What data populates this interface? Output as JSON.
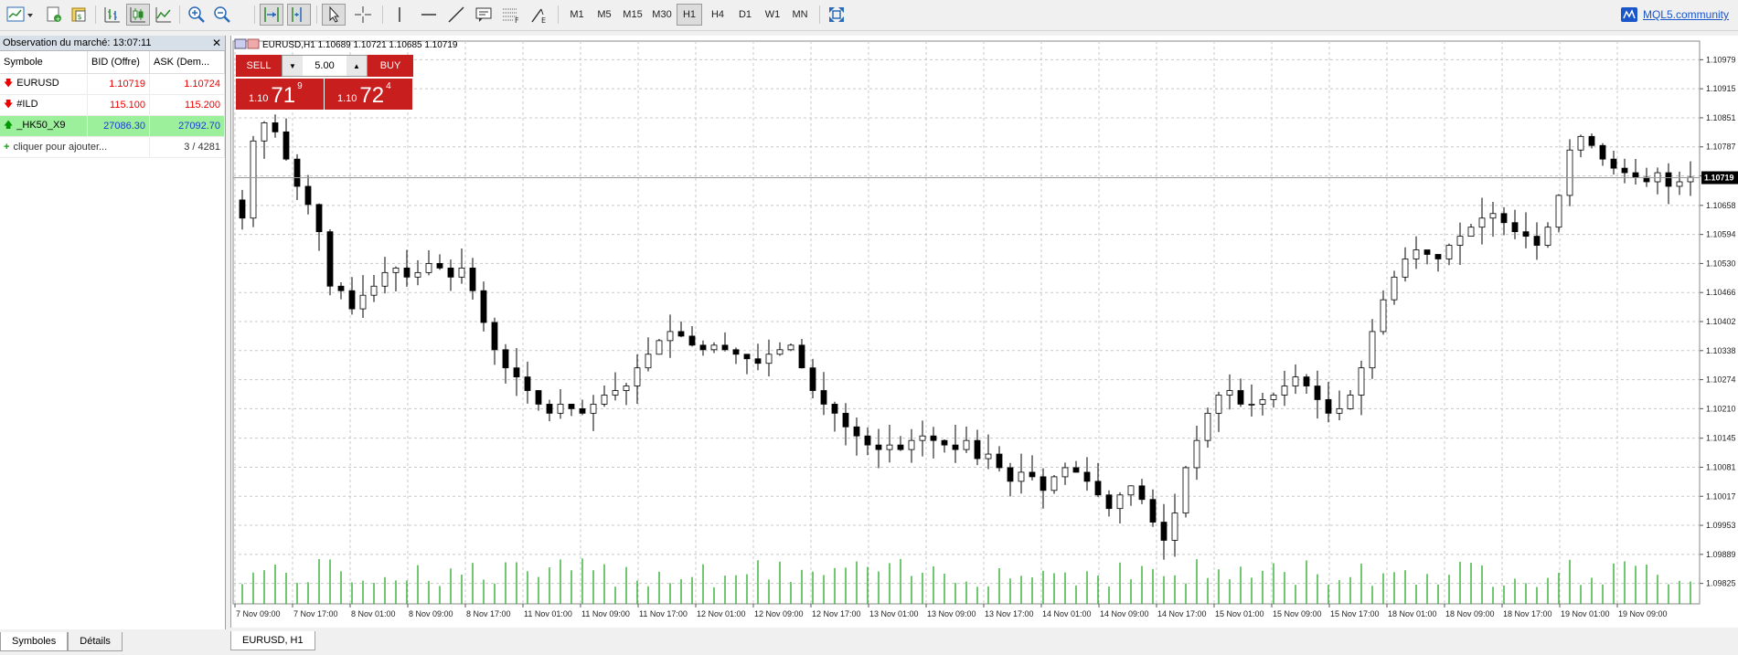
{
  "toolbar": {
    "timeframes": [
      "M1",
      "M5",
      "M15",
      "M30",
      "H1",
      "H4",
      "D1",
      "W1",
      "MN"
    ],
    "active_timeframe": "H1",
    "community_label": "MQL5.community"
  },
  "market_watch": {
    "title": "Observation du marché: 13:07:11",
    "columns": [
      "Symbole",
      "BID (Offre)",
      "ASK (Dem..."
    ],
    "rows": [
      {
        "symbol": "EURUSD",
        "bid": "1.10719",
        "ask": "1.10724",
        "dir": "down"
      },
      {
        "symbol": "#ILD",
        "bid": "115.100",
        "ask": "115.200",
        "dir": "down"
      },
      {
        "symbol": "_HK50_X9",
        "bid": "27086.30",
        "ask": "27092.70",
        "dir": "up"
      }
    ],
    "add_label": "cliquer pour ajouter...",
    "count": "3 / 4281"
  },
  "bottom_tabs": {
    "symbols": "Symboles",
    "details": "Détails"
  },
  "chart": {
    "header": "EURUSD,H1  1.10689 1.10721 1.10685 1.10719",
    "tab_label": "EURUSD, H1",
    "current_price_label": "1.10719",
    "colors": {
      "bull": "#ffffff",
      "bear": "#000000",
      "volume": "#22aa22",
      "grid": "#c8c8c8",
      "price_tag_bg": "#000000"
    }
  },
  "trade_panel": {
    "sell_label": "SELL",
    "buy_label": "BUY",
    "lot": "5.00",
    "sell_prefix": "1.10",
    "sell_big": "71",
    "sell_sup": "9",
    "buy_prefix": "1.10",
    "buy_big": "72",
    "buy_sup": "4"
  },
  "chart_data": {
    "type": "candlestick",
    "y_ticks": [
      "1.10979",
      "1.10915",
      "1.10851",
      "1.10787",
      "1.10723",
      "1.10658",
      "1.10594",
      "1.10530",
      "1.10466",
      "1.10402",
      "1.10338",
      "1.10274",
      "1.10210",
      "1.10145",
      "1.10081",
      "1.10017",
      "1.09953",
      "1.09889",
      "1.09825"
    ],
    "ylim": [
      1.0978,
      1.1102
    ],
    "x_ticks": [
      "7 Nov 09:00",
      "7 Nov 17:00",
      "8 Nov 01:00",
      "8 Nov 09:00",
      "8 Nov 17:00",
      "11 Nov 01:00",
      "11 Nov 09:00",
      "11 Nov 17:00",
      "12 Nov 01:00",
      "12 Nov 09:00",
      "12 Nov 17:00",
      "13 Nov 01:00",
      "13 Nov 09:00",
      "13 Nov 17:00",
      "14 Nov 01:00",
      "14 Nov 09:00",
      "14 Nov 17:00",
      "15 Nov 01:00",
      "15 Nov 09:00",
      "15 Nov 17:00",
      "18 Nov 01:00",
      "18 Nov 09:00",
      "18 Nov 17:00",
      "19 Nov 01:00",
      "19 Nov 09:00"
    ],
    "close_path": [
      1.1063,
      1.108,
      1.1084,
      1.1082,
      1.1076,
      1.107,
      1.1066,
      1.106,
      1.1048,
      1.1047,
      1.1043,
      1.1046,
      1.1048,
      1.1051,
      1.1052,
      1.105,
      1.1051,
      1.1053,
      1.1052,
      1.105,
      1.1052,
      1.1047,
      1.104,
      1.1034,
      1.103,
      1.1028,
      1.1025,
      1.1022,
      1.102,
      1.1022,
      1.1021,
      1.102,
      1.1022,
      1.1024,
      1.1025,
      1.1026,
      1.103,
      1.1033,
      1.1036,
      1.1038,
      1.1037,
      1.1035,
      1.1034,
      1.1035,
      1.1034,
      1.1033,
      1.1032,
      1.1031,
      1.1033,
      1.1034,
      1.1035,
      1.103,
      1.1025,
      1.1022,
      1.102,
      1.1017,
      1.1015,
      1.1013,
      1.1012,
      1.1013,
      1.1012,
      1.1014,
      1.1015,
      1.1014,
      1.1013,
      1.1012,
      1.1014,
      1.101,
      1.1011,
      1.1008,
      1.1005,
      1.1007,
      1.1006,
      1.1003,
      1.1006,
      1.1008,
      1.1007,
      1.1005,
      1.1002,
      1.0999,
      1.1002,
      1.1004,
      1.1001,
      1.0996,
      1.0992,
      1.0998,
      1.1008,
      1.1014,
      1.102,
      1.1024,
      1.1025,
      1.1022,
      1.1022,
      1.1023,
      1.1024,
      1.1026,
      1.1028,
      1.1026,
      1.1023,
      1.102,
      1.1021,
      1.1024,
      1.103,
      1.1038,
      1.1045,
      1.105,
      1.1054,
      1.1056,
      1.1055,
      1.1054,
      1.1057,
      1.1059,
      1.1061,
      1.1063,
      1.1064,
      1.1062,
      1.106,
      1.1059,
      1.1057,
      1.1061,
      1.1068,
      1.1078,
      1.1081,
      1.1079,
      1.1076,
      1.1074,
      1.1073,
      1.1072,
      1.1071,
      1.1073,
      1.107,
      1.1071,
      1.1072
    ]
  }
}
